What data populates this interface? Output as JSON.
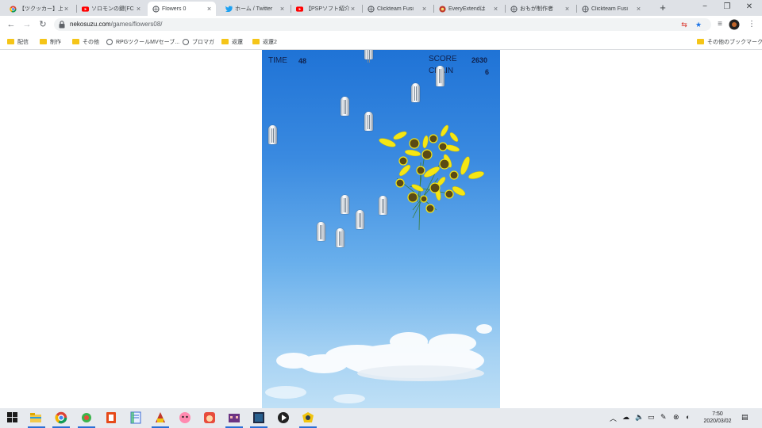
{
  "browser": {
    "tabs": [
      {
        "title": "【ツクッカー】上級",
        "icon": "chrome-logo-icon",
        "active": false
      },
      {
        "title": "ソロモンの鍵(FC",
        "icon": "youtube-icon",
        "active": false
      },
      {
        "title": "Flowers 0",
        "icon": "globe-icon",
        "active": true
      },
      {
        "title": "ホーム / Twitter",
        "icon": "twitter-icon",
        "active": false
      },
      {
        "title": "【PSPソフト紹介】",
        "icon": "youtube-icon",
        "active": false
      },
      {
        "title": "Clickteam Fusi",
        "icon": "globe-icon",
        "active": false
      },
      {
        "title": "EveryExtendは",
        "icon": "game-icon",
        "active": false
      },
      {
        "title": "おもが制作者",
        "icon": "globe-icon",
        "active": false
      },
      {
        "title": "Clickteam Fusi",
        "icon": "globe-icon",
        "active": false
      }
    ],
    "new_tab_label": "+",
    "window_controls": {
      "minimize": "−",
      "restore": "❐",
      "close": "✕"
    },
    "address": {
      "host": "nekosuzu.com",
      "path": "/games/flowers08/"
    },
    "bookmarks": [
      {
        "label": "配信",
        "icon": "folder-icon"
      },
      {
        "label": "制作",
        "icon": "folder-icon"
      },
      {
        "label": "その他",
        "icon": "folder-icon"
      },
      {
        "label": "RPGツクールMVセーブ...",
        "icon": "globe-icon"
      },
      {
        "label": "ブロマガ",
        "icon": "globe-icon"
      },
      {
        "label": "返還",
        "icon": "folder-icon"
      },
      {
        "label": "返還2",
        "icon": "folder-icon"
      }
    ],
    "other_bookmarks": "その他のブックマーク"
  },
  "game": {
    "time_label": "TIME",
    "time_value": "48",
    "score_label": "SCORE",
    "score_value": "2630",
    "chain_label": "CHAIN",
    "chain_value": "6"
  },
  "taskbar": {
    "clock_time": "7:50",
    "clock_date": "2020/03/02"
  },
  "colors": {
    "sky_top": "#1f73d6",
    "sky_bottom": "#bfe0f6",
    "flower_petal": "#f5e614",
    "flower_center": "#5a4a14"
  }
}
